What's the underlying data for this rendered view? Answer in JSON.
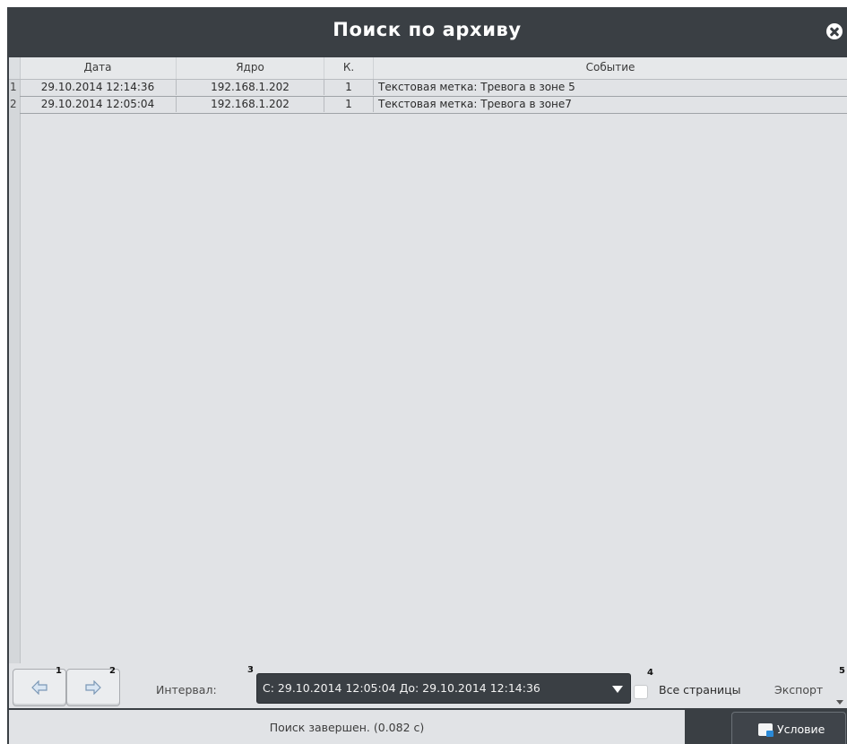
{
  "window": {
    "title": "Поиск по архиву"
  },
  "table": {
    "headers": [
      "Дата",
      "Ядро",
      "К.",
      "Событие"
    ],
    "rows": [
      {
        "index": "1",
        "date": "29.10.2014 12:14:36",
        "core": "192.168.1.202",
        "k": "1",
        "event": "Текстовая метка: Тревога в зоне 5"
      },
      {
        "index": "2",
        "date": "29.10.2014 12:05:04",
        "core": "192.168.1.202",
        "k": "1",
        "event": "Текстовая метка: Тревога в зоне7"
      }
    ]
  },
  "toolbar": {
    "badges": [
      "1",
      "2",
      "3",
      "4",
      "5"
    ],
    "interval_label": "Интервал:",
    "interval_value": "С: 29.10.2014 12:05:04   До: 29.10.2014 12:14:36",
    "all_pages_label": "Все страницы",
    "all_pages_checked": false,
    "export_label": "Экспорт"
  },
  "status": {
    "text": "Поиск завершен. (0.082 с)",
    "condition_button": "Условие"
  },
  "icons": [
    "close-icon",
    "arrow-left-icon",
    "arrow-right-icon",
    "dropdown-arrow-icon",
    "condition-icon"
  ],
  "colors": {
    "titlebar": "#3a3f44",
    "panel": "#e1e3e6",
    "accent": "#2b8ad8"
  }
}
